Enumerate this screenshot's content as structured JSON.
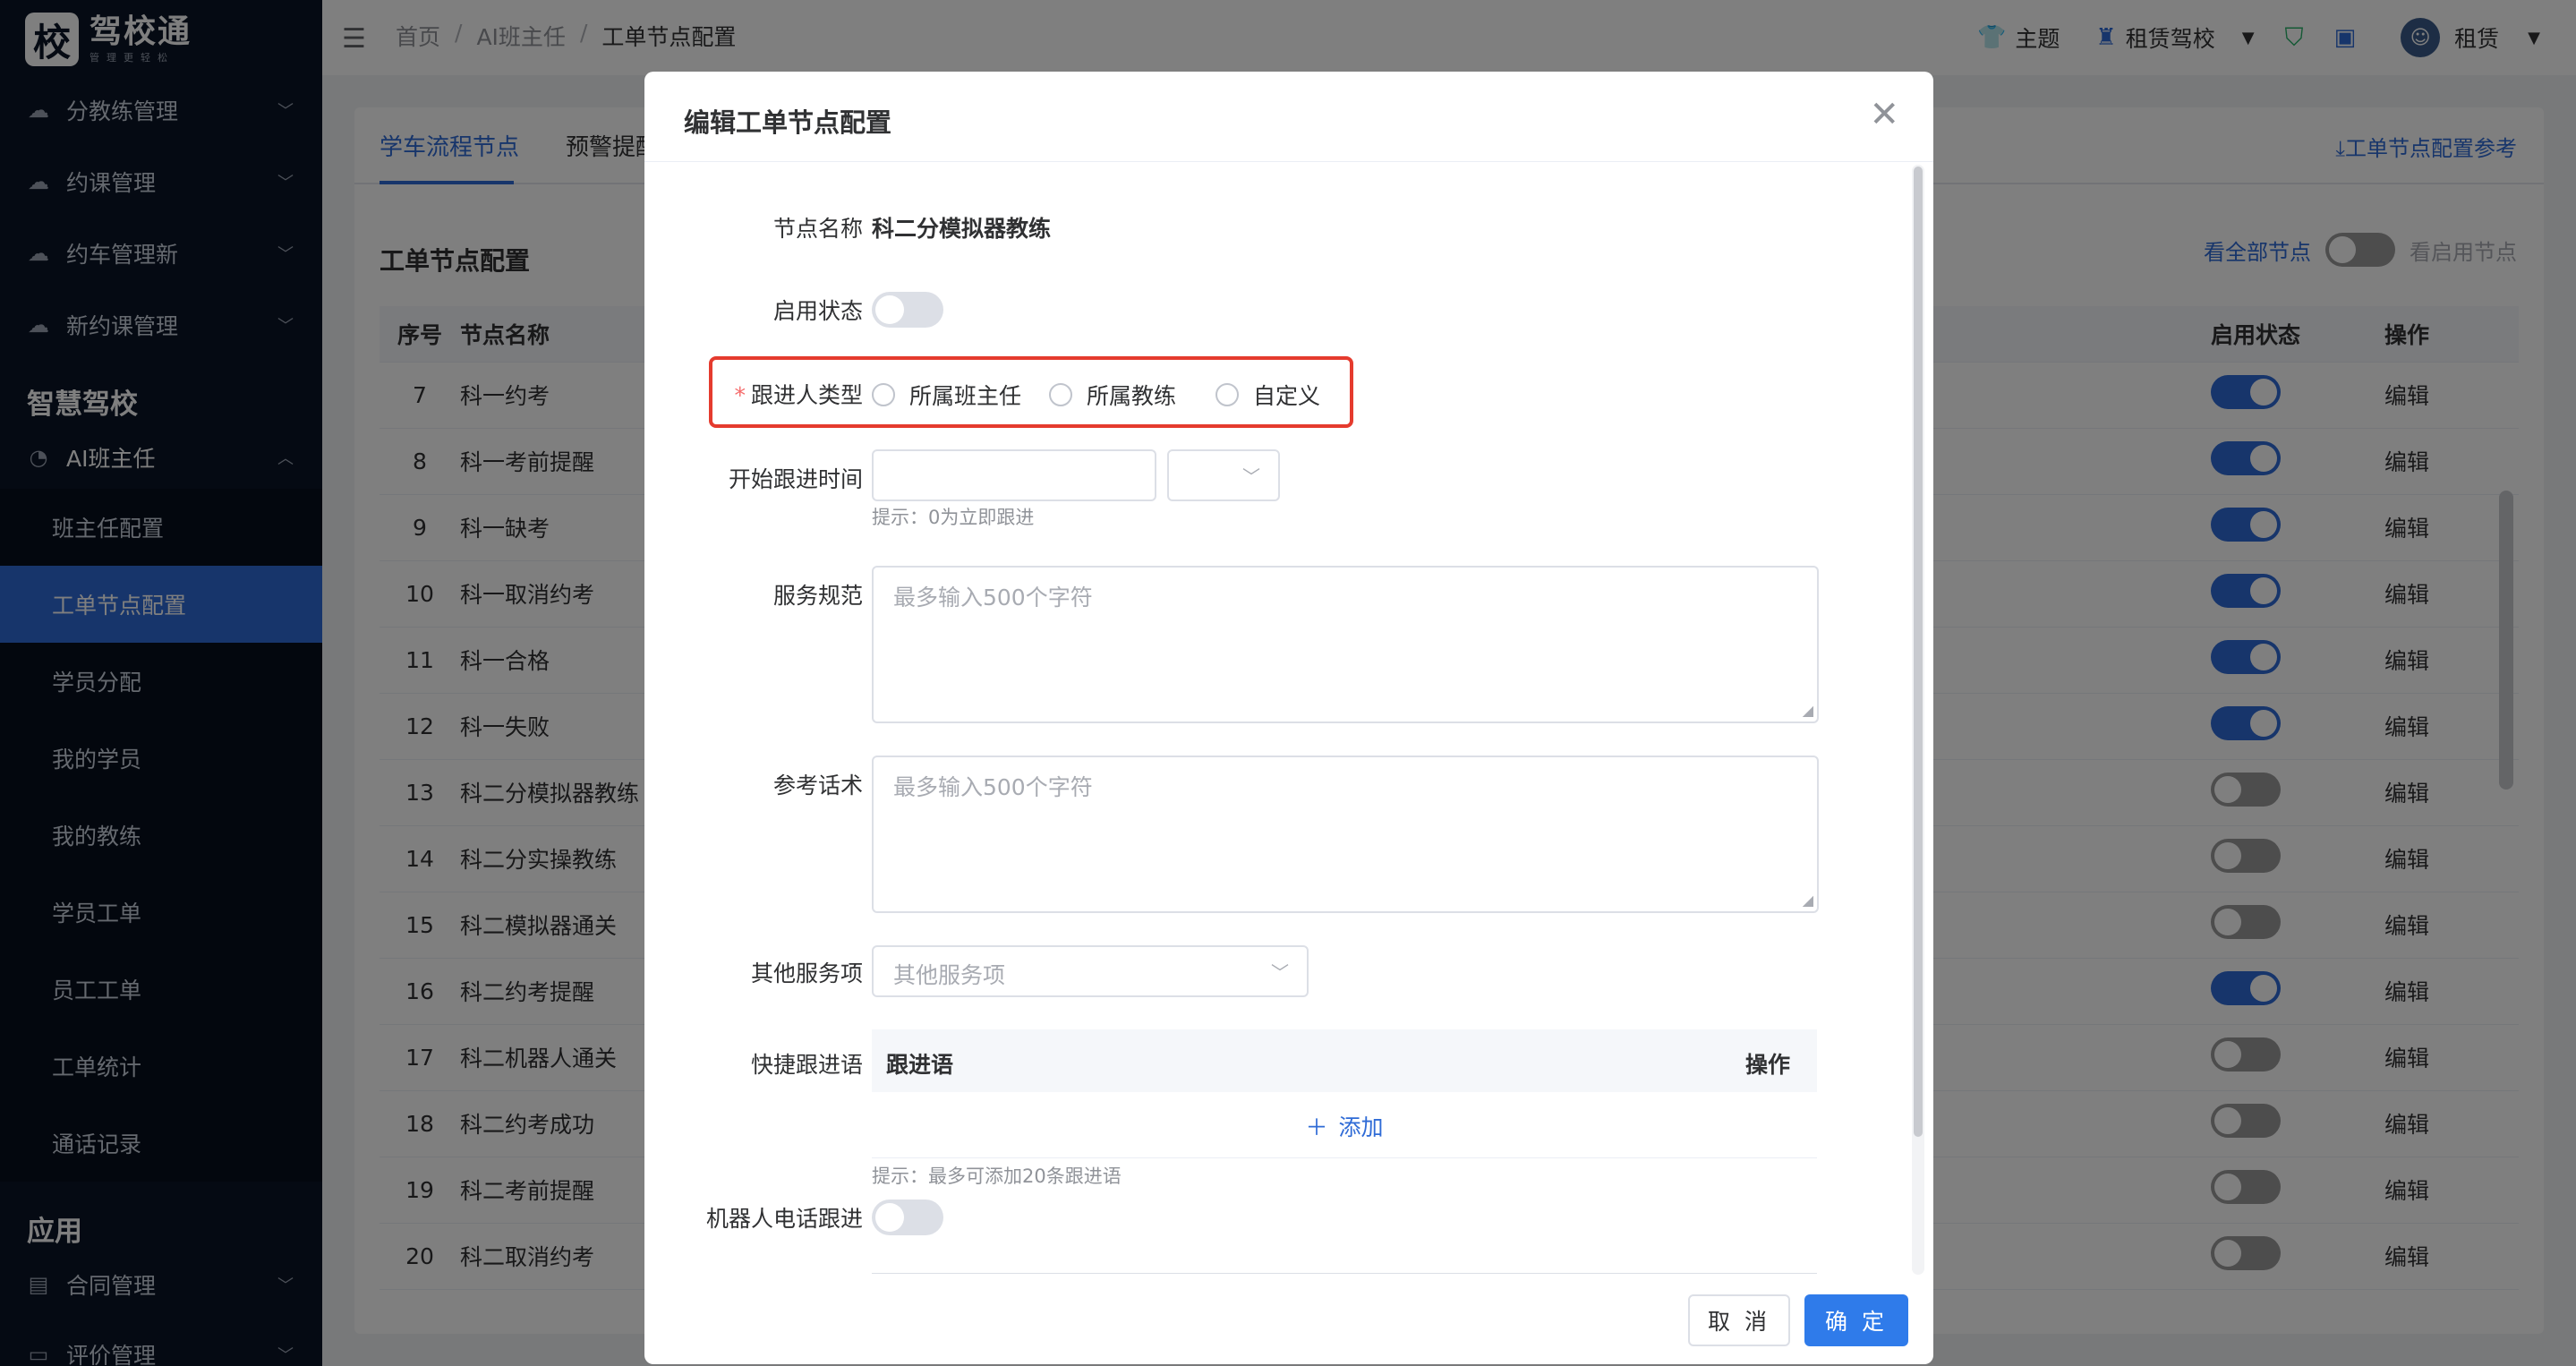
{
  "brand": {
    "logo_char": "校",
    "name": "驾校通",
    "tagline": "管理更轻松"
  },
  "sidebar": {
    "top_items": [
      {
        "label": "分教练管理"
      },
      {
        "label": "约课管理"
      },
      {
        "label": "约车管理新"
      },
      {
        "label": "新约课管理"
      }
    ],
    "group_smart": "智慧驾校",
    "ai_menu": {
      "label": "AI班主任"
    },
    "ai_subitems": [
      {
        "label": "班主任配置"
      },
      {
        "label": "工单节点配置"
      },
      {
        "label": "学员分配"
      },
      {
        "label": "我的学员"
      },
      {
        "label": "我的教练"
      },
      {
        "label": "学员工单"
      },
      {
        "label": "员工工单"
      },
      {
        "label": "工单统计"
      },
      {
        "label": "通话记录"
      }
    ],
    "group_app": "应用",
    "app_items": [
      {
        "label": "合同管理"
      },
      {
        "label": "评价管理"
      }
    ]
  },
  "topbar": {
    "breadcrumb": [
      "首页",
      "AI班主任",
      "工单节点配置"
    ],
    "theme": "主题",
    "school": "租赁驾校",
    "user": "租赁"
  },
  "content": {
    "tabs": [
      "学车流程节点",
      "预警提醒"
    ],
    "ref_link": "⤓工单节点配置参考",
    "section_title": "工单节点配置",
    "view_all": "看全部节点",
    "view_enabled": "看启用节点",
    "columns": {
      "no": "序号",
      "name": "节点名称",
      "status": "启用状态",
      "action": "操作"
    },
    "rows": [
      {
        "no": "7",
        "name": "科一约考",
        "on": true,
        "action": "编辑"
      },
      {
        "no": "8",
        "name": "科一考前提醒",
        "on": true,
        "action": "编辑"
      },
      {
        "no": "9",
        "name": "科一缺考",
        "on": true,
        "action": "编辑"
      },
      {
        "no": "10",
        "name": "科一取消约考",
        "on": true,
        "action": "编辑"
      },
      {
        "no": "11",
        "name": "科一合格",
        "on": true,
        "action": "编辑"
      },
      {
        "no": "12",
        "name": "科一失败",
        "on": true,
        "action": "编辑"
      },
      {
        "no": "13",
        "name": "科二分模拟器教练",
        "on": false,
        "action": "编辑"
      },
      {
        "no": "14",
        "name": "科二分实操教练",
        "on": false,
        "action": "编辑"
      },
      {
        "no": "15",
        "name": "科二模拟器通关",
        "on": false,
        "action": "编辑"
      },
      {
        "no": "16",
        "name": "科二约考提醒",
        "on": true,
        "action": "编辑"
      },
      {
        "no": "17",
        "name": "科二机器人通关",
        "on": false,
        "action": "编辑"
      },
      {
        "no": "18",
        "name": "科二约考成功",
        "on": false,
        "action": "编辑"
      },
      {
        "no": "19",
        "name": "科二考前提醒",
        "on": false,
        "action": "编辑"
      },
      {
        "no": "20",
        "name": "科二取消约考",
        "on": false,
        "action": "编辑"
      }
    ]
  },
  "dialog": {
    "title": "编辑工单节点配置",
    "fields": {
      "node_name_label": "节点名称",
      "node_name_value": "科二分模拟器教练",
      "enable_label": "启用状态",
      "follower_type_label": "跟进人类型",
      "follower_options": [
        "所属班主任",
        "所属教练",
        "自定义"
      ],
      "start_time_label": "开始跟进时间",
      "start_time_hint": "提示：0为立即跟进",
      "service_spec_label": "服务规范",
      "service_spec_placeholder": "最多输入500个字符",
      "ref_script_label": "参考话术",
      "ref_script_placeholder": "最多输入500个字符",
      "other_service_label": "其他服务项",
      "other_service_placeholder": "其他服务项",
      "quick_label": "快捷跟进语",
      "quick_col_text": "跟进语",
      "quick_col_action": "操作",
      "quick_add": "添加",
      "quick_hint": "提示：最多可添加20条跟进语",
      "robot_label": "机器人电话跟进"
    },
    "cancel": "取 消",
    "confirm": "确 定"
  }
}
